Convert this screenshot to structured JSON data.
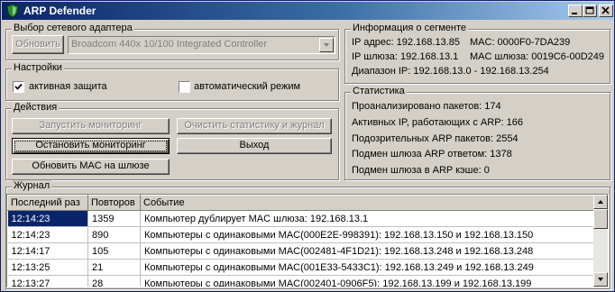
{
  "window": {
    "title": "ARP Defender"
  },
  "adapter": {
    "legend": "Выбор сетевого адаптера",
    "refresh_label": "Обновить",
    "selected": "Broadcom 440x 10/100 Integrated Controller"
  },
  "settings": {
    "legend": "Настройки",
    "active_protection": {
      "label": "активная защита",
      "checked": true
    },
    "auto_mode": {
      "label": "автоматический режим",
      "checked": false
    }
  },
  "actions": {
    "legend": "Действия",
    "start_label": "Запустить мониторинг",
    "clear_label": "Очистить статистику и журнал",
    "stop_label": "Остановить мониторинг",
    "exit_label": "Выход",
    "update_mac_label": "Обновить MAC на шлюзе"
  },
  "segment": {
    "legend": "Информация о сегменте",
    "ip": "IP адрес: 192.168.13.85",
    "mac": "MAC: 0000F0-7DA239",
    "gateway_ip": "IP шлюза: 192.168.13.1",
    "gateway_mac": "MAC шлюза: 0019C6-00D249",
    "range": "Диапазон IP: 192.168.13.0 - 192.168.13.254"
  },
  "stats": {
    "legend": "Статистика",
    "lines": [
      "Проанализировано пакетов: 174",
      "Активных IP, работающих с ARP: 166",
      "Подозрительных ARP пакетов: 2554",
      "Подмен шлюза ARP ответом: 1378",
      "Подмен шлюза в ARP кэше: 0"
    ]
  },
  "journal": {
    "legend": "Журнал",
    "columns": [
      "Последний раз",
      "Повторов",
      "Событие"
    ],
    "rows": [
      [
        "12:14:23",
        "1359",
        "Компьютер дублирует MAC шлюза: 192.168.13.1"
      ],
      [
        "12:14:23",
        "890",
        "Компьютеры с одинаковыми MAC(000E2E-998391): 192.168.13.150 и 192.168.13.150"
      ],
      [
        "12:14:17",
        "105",
        "Компьютеры с одинаковыми MAC(002481-4F1D21): 192.168.13.248 и 192.168.13.248"
      ],
      [
        "12:13:25",
        "21",
        "Компьютеры с одинаковыми MAC(001E33-5433C1): 192.168.13.249 и 192.168.13.249"
      ],
      [
        "12:13:27",
        "28",
        "Компьютеры с одинаковыми MAC(002401-0906F5): 192.168.13.199 и 192.168.13.199"
      ]
    ]
  }
}
